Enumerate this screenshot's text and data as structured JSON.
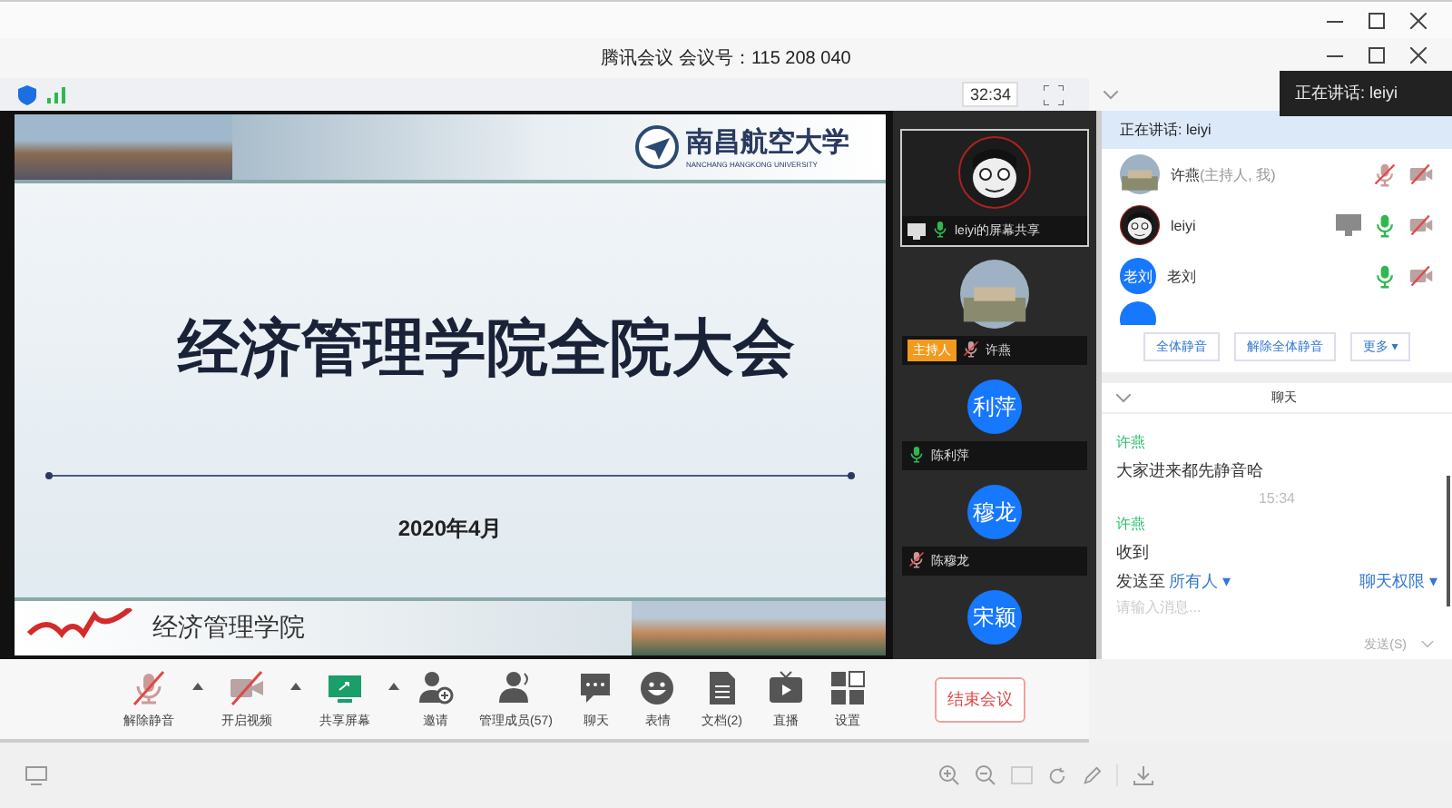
{
  "window": {
    "title": "腾讯会议 会议号：115 208 040"
  },
  "top_bar": {
    "timer": "32:34"
  },
  "speaking_tooltip": "正在讲话: leiyi",
  "slide": {
    "university": "南昌航空大学",
    "university_en": "NANCHANG HANGKONG UNIVERSITY",
    "title": "经济管理学院全院大会",
    "date": "2020年4月",
    "footer": "经济管理学院"
  },
  "video_tiles": [
    {
      "kind": "cartoon",
      "label": "leiyi的屏幕共享",
      "mic_on": true,
      "selected": true,
      "sharing": true
    },
    {
      "kind": "photo",
      "label": "许燕",
      "host_badge": "主持人",
      "mic_on": false,
      "selected": false,
      "sharing": false
    },
    {
      "kind": "initials",
      "initials": "利萍",
      "label": "陈利萍",
      "mic_on": true,
      "selected": false,
      "sharing": false
    },
    {
      "kind": "initials",
      "initials": "穆龙",
      "label": "陈穆龙",
      "mic_on": false,
      "selected": false,
      "sharing": false
    },
    {
      "kind": "initials",
      "initials": "宋颖",
      "selected": false
    }
  ],
  "members": {
    "speaking": "正在讲话: leiyi",
    "list": [
      {
        "kind": "photo",
        "name": "许燕",
        "note": "(主持人, 我)",
        "sharing": false,
        "mic_on": false,
        "camera_on": false
      },
      {
        "kind": "cartoon",
        "name": "leiyi",
        "sharing": true,
        "mic_on": true,
        "camera_on": false
      },
      {
        "kind": "initials",
        "initials": "老刘",
        "name": "老刘",
        "sharing": false,
        "mic_on": true,
        "camera_on": false
      }
    ],
    "buttons": [
      "全体静音",
      "解除全体静音",
      "更多 ▾"
    ]
  },
  "chat": {
    "title": "聊天",
    "messages": [
      {
        "kind": "message",
        "sender": "许燕",
        "text": "大家进来都先静音哈"
      },
      {
        "kind": "time",
        "text": "15:34"
      },
      {
        "kind": "message",
        "sender": "许燕",
        "text": "收到"
      }
    ],
    "send_to_label": "发送至",
    "send_to": "所有人 ▾",
    "permission": "聊天权限 ▾",
    "placeholder": "请输入消息...",
    "send_button": "发送(S)"
  },
  "toolbar": [
    {
      "kind": "mic",
      "label": "解除静音",
      "off": true,
      "caret": true
    },
    {
      "kind": "video",
      "label": "开启视频",
      "off": true,
      "caret": true
    },
    {
      "kind": "share",
      "label": "共享屏幕",
      "off": false,
      "caret": true
    },
    {
      "kind": "invite",
      "label": "邀请",
      "off": false,
      "caret": false
    },
    {
      "kind": "members",
      "label": "管理成员(57)",
      "off": false,
      "caret": false
    },
    {
      "kind": "chat",
      "label": "聊天",
      "off": false,
      "caret": false
    },
    {
      "kind": "emoji",
      "label": "表情",
      "off": false,
      "caret": false
    },
    {
      "kind": "doc",
      "label": "文档(2)",
      "off": false,
      "caret": false
    },
    {
      "kind": "live",
      "label": "直播",
      "off": false,
      "caret": false
    },
    {
      "kind": "settings",
      "label": "设置",
      "off": false,
      "caret": false
    }
  ],
  "end_button": "结束会议"
}
